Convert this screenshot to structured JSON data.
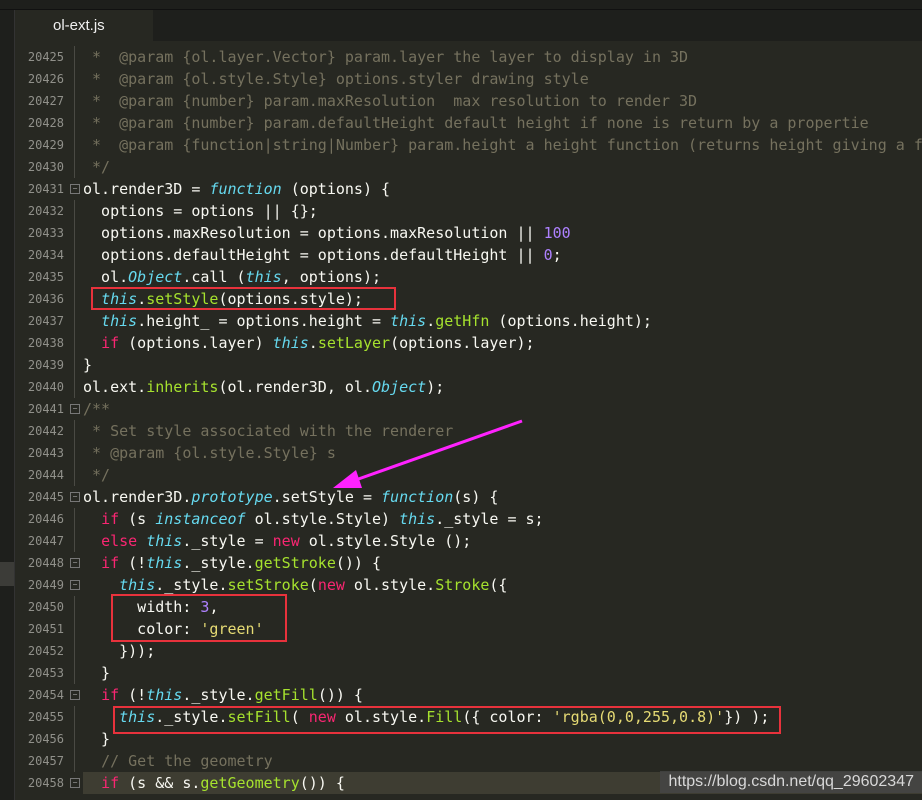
{
  "tab": {
    "name": "ol-ext.js"
  },
  "colors": {
    "background": "#272822",
    "comment": "#75715e",
    "keyword": "#f92672",
    "storage": "#66d9ef",
    "function": "#a6e22e",
    "number": "#ae81ff",
    "string": "#e6db74",
    "annotation_box": "#e8323c",
    "annotation_arrow": "#ff22ff"
  },
  "lines": [
    {
      "num": "20425",
      "t": [
        [
          "c",
          " *  @param {ol.layer.Vector} param.layer the layer to display in 3D"
        ]
      ]
    },
    {
      "num": "20426",
      "t": [
        [
          "c",
          " *  @param {ol.style.Style} options.styler drawing style"
        ]
      ]
    },
    {
      "num": "20427",
      "t": [
        [
          "c",
          " *  @param {number} param.maxResolution  max resolution to render 3D"
        ]
      ]
    },
    {
      "num": "20428",
      "t": [
        [
          "c",
          " *  @param {number} param.defaultHeight default height if none is return by a propertie"
        ]
      ]
    },
    {
      "num": "20429",
      "t": [
        [
          "c",
          " *  @param {function|string|Number} param.height a height function (returns height giving a fe"
        ]
      ]
    },
    {
      "num": "20430",
      "t": [
        [
          "c",
          " */"
        ]
      ]
    },
    {
      "num": "20431",
      "fold": true,
      "t": [
        [
          "",
          "ol.render3D = "
        ],
        [
          "s",
          "function"
        ],
        [
          "",
          " (options) {"
        ]
      ]
    },
    {
      "num": "20432",
      "t": [
        [
          "",
          "  options = options || {};"
        ]
      ]
    },
    {
      "num": "20433",
      "t": [
        [
          "",
          "  options.maxResolution = options.maxResolution || "
        ],
        [
          "n",
          "100"
        ]
      ]
    },
    {
      "num": "20434",
      "t": [
        [
          "",
          "  options.defaultHeight = options.defaultHeight || "
        ],
        [
          "n",
          "0"
        ],
        [
          "",
          ";"
        ]
      ]
    },
    {
      "num": "20435",
      "t": [
        [
          "",
          "  ol."
        ],
        [
          "s",
          "Object"
        ],
        [
          "",
          ".call ("
        ],
        [
          "s",
          "this"
        ],
        [
          "",
          ", options);"
        ]
      ]
    },
    {
      "num": "20436",
      "t": [
        [
          "",
          "  "
        ],
        [
          "s",
          "this"
        ],
        [
          "",
          "."
        ],
        [
          "f",
          "setStyle"
        ],
        [
          "",
          "(options.style);"
        ]
      ]
    },
    {
      "num": "20437",
      "t": [
        [
          "",
          "  "
        ],
        [
          "s",
          "this"
        ],
        [
          "",
          ".height_ = options.height = "
        ],
        [
          "s",
          "this"
        ],
        [
          "",
          "."
        ],
        [
          "f",
          "getHfn"
        ],
        [
          "",
          " (options.height);"
        ]
      ]
    },
    {
      "num": "20438",
      "t": [
        [
          "",
          "  "
        ],
        [
          "k",
          "if"
        ],
        [
          "",
          " (options.layer) "
        ],
        [
          "s",
          "this"
        ],
        [
          "",
          "."
        ],
        [
          "f",
          "setLayer"
        ],
        [
          "",
          "(options.layer);"
        ]
      ]
    },
    {
      "num": "20439",
      "t": [
        [
          "",
          "}"
        ]
      ]
    },
    {
      "num": "20440",
      "t": [
        [
          "",
          "ol.ext."
        ],
        [
          "f",
          "inherits"
        ],
        [
          "",
          "(ol.render3D, ol."
        ],
        [
          "s",
          "Object"
        ],
        [
          "",
          ");"
        ]
      ]
    },
    {
      "num": "20441",
      "fold": true,
      "t": [
        [
          "c",
          "/**"
        ]
      ]
    },
    {
      "num": "20442",
      "t": [
        [
          "c",
          " * Set style associated with the renderer"
        ]
      ]
    },
    {
      "num": "20443",
      "t": [
        [
          "c",
          " * @param {ol.style.Style} s"
        ]
      ]
    },
    {
      "num": "20444",
      "t": [
        [
          "c",
          " */"
        ]
      ]
    },
    {
      "num": "20445",
      "fold": true,
      "t": [
        [
          "",
          "ol.render3D."
        ],
        [
          "s",
          "prototype"
        ],
        [
          "",
          ".setStyle = "
        ],
        [
          "s",
          "function"
        ],
        [
          "",
          "(s) {"
        ]
      ]
    },
    {
      "num": "20446",
      "t": [
        [
          "",
          "  "
        ],
        [
          "k",
          "if"
        ],
        [
          "",
          " (s "
        ],
        [
          "s",
          "instanceof"
        ],
        [
          "",
          " ol.style.Style) "
        ],
        [
          "s",
          "this"
        ],
        [
          "",
          "._style = s;"
        ]
      ]
    },
    {
      "num": "20447",
      "t": [
        [
          "",
          "  "
        ],
        [
          "k",
          "else"
        ],
        [
          "",
          " "
        ],
        [
          "s",
          "this"
        ],
        [
          "",
          "._style = "
        ],
        [
          "k",
          "new"
        ],
        [
          "",
          " ol.style.Style ();"
        ]
      ]
    },
    {
      "num": "20448",
      "fold": true,
      "t": [
        [
          "",
          "  "
        ],
        [
          "k",
          "if"
        ],
        [
          "",
          " (!"
        ],
        [
          "s",
          "this"
        ],
        [
          "",
          "._style."
        ],
        [
          "f",
          "getStroke"
        ],
        [
          "",
          "()) {"
        ]
      ]
    },
    {
      "num": "20449",
      "fold": true,
      "t": [
        [
          "",
          "    "
        ],
        [
          "s",
          "this"
        ],
        [
          "",
          "._style."
        ],
        [
          "f",
          "setStroke"
        ],
        [
          "",
          "("
        ],
        [
          "k",
          "new"
        ],
        [
          "",
          " ol.style."
        ],
        [
          "f",
          "Stroke"
        ],
        [
          "",
          "({"
        ]
      ]
    },
    {
      "num": "20450",
      "t": [
        [
          "",
          "      width: "
        ],
        [
          "n",
          "3"
        ],
        [
          "",
          ","
        ]
      ]
    },
    {
      "num": "20451",
      "t": [
        [
          "",
          "      color: "
        ],
        [
          "str",
          "'green'"
        ]
      ]
    },
    {
      "num": "20452",
      "t": [
        [
          "",
          "    }));"
        ]
      ]
    },
    {
      "num": "20453",
      "t": [
        [
          "",
          "  }"
        ]
      ]
    },
    {
      "num": "20454",
      "fold": true,
      "t": [
        [
          "",
          "  "
        ],
        [
          "k",
          "if"
        ],
        [
          "",
          " (!"
        ],
        [
          "s",
          "this"
        ],
        [
          "",
          "._style."
        ],
        [
          "f",
          "getFill"
        ],
        [
          "",
          "()) {"
        ]
      ]
    },
    {
      "num": "20455",
      "t": [
        [
          "",
          "    "
        ],
        [
          "s",
          "this"
        ],
        [
          "",
          "._style."
        ],
        [
          "f",
          "setFill"
        ],
        [
          "",
          "( "
        ],
        [
          "k",
          "new"
        ],
        [
          "",
          " ol.style."
        ],
        [
          "f",
          "Fill"
        ],
        [
          "",
          "({ color: "
        ],
        [
          "str",
          "'rgba(0,0,255,0.8)'"
        ],
        [
          "",
          "}) );"
        ]
      ]
    },
    {
      "num": "20456",
      "t": [
        [
          "",
          "  }"
        ]
      ]
    },
    {
      "num": "20457",
      "t": [
        [
          "",
          "  "
        ],
        [
          "c",
          "// Get the geometry"
        ]
      ]
    },
    {
      "num": "20458",
      "fold": true,
      "current": true,
      "t": [
        [
          "",
          "  "
        ],
        [
          "k",
          "if"
        ],
        [
          "",
          " (s && s."
        ],
        [
          "f",
          "getGeometry"
        ],
        [
          "",
          "()) {"
        ]
      ]
    }
  ],
  "watermark": "https://blog.csdn.net/qq_29602347"
}
